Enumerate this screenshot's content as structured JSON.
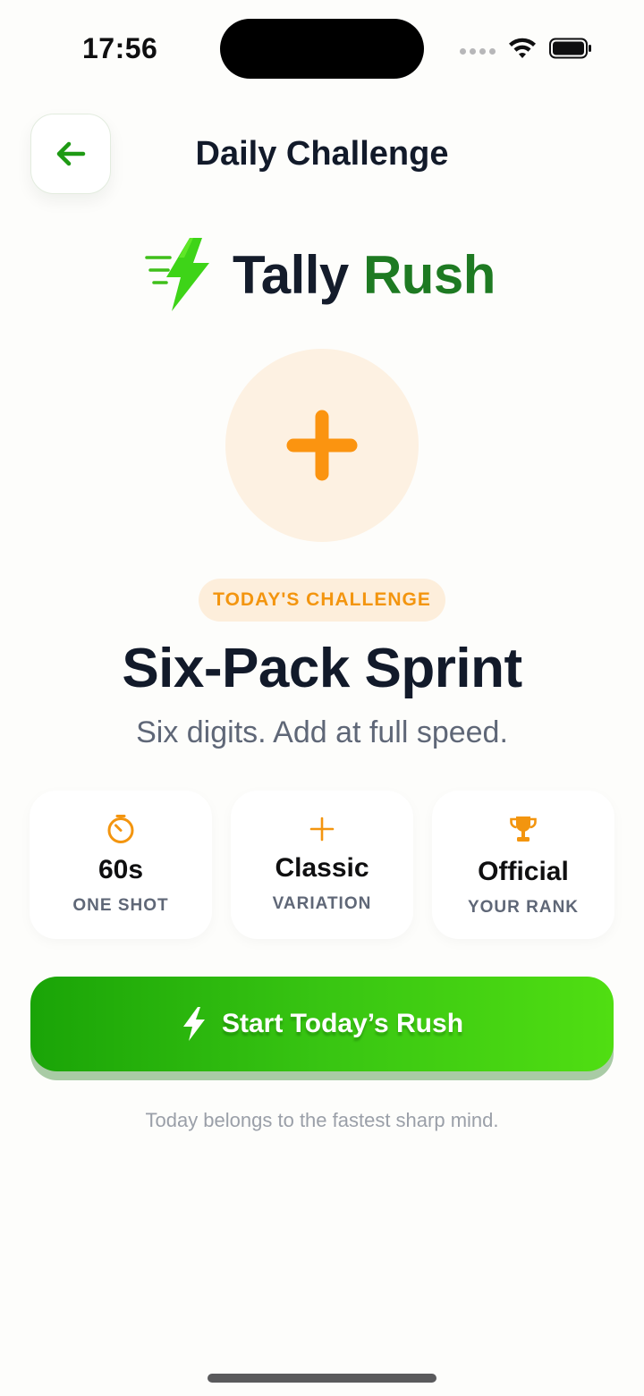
{
  "status_bar": {
    "time": "17:56"
  },
  "header": {
    "title": "Daily Challenge",
    "back_icon": "arrow-left-icon"
  },
  "logo": {
    "word_1": "Tally",
    "word_2": "Rush",
    "icon": "lightning-bolt-icon"
  },
  "hero": {
    "icon": "plus-icon"
  },
  "challenge": {
    "badge": "TODAY'S CHALLENGE",
    "title": "Six-Pack Sprint",
    "subtitle": "Six digits. Add at full speed."
  },
  "stats": [
    {
      "icon": "timer-icon",
      "value": "60s",
      "label": "ONE SHOT"
    },
    {
      "icon": "plus-icon",
      "value": "Classic",
      "label": "VARIATION"
    },
    {
      "icon": "trophy-icon",
      "value": "Official",
      "label": "YOUR RANK"
    }
  ],
  "cta": {
    "label": "Start Today’s Rush",
    "icon": "lightning-bolt-icon"
  },
  "footer_note": "Today belongs to the fastest sharp mind.",
  "colors": {
    "accent_green": "#1e7a22",
    "button_green_start": "#1aa407",
    "button_green_end": "#50de12",
    "accent_orange": "#f3950f",
    "background": "#fdfdfb"
  }
}
